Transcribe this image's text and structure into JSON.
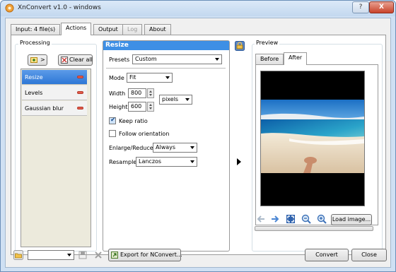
{
  "window": {
    "title": "XnConvert v1.0 - windows",
    "help_label": "?",
    "close_label": "X"
  },
  "tabs": [
    {
      "label": "Input: 4 file(s)",
      "state": "normal"
    },
    {
      "label": "Actions",
      "state": "active"
    },
    {
      "label": "Output",
      "state": "normal"
    },
    {
      "label": "Log",
      "state": "disabled"
    },
    {
      "label": "About",
      "state": "normal"
    }
  ],
  "processing": {
    "title": "Processing",
    "add_button_label": ">",
    "clear_label": "Clear all",
    "items": [
      {
        "label": "Resize",
        "selected": true
      },
      {
        "label": "Levels",
        "selected": false
      },
      {
        "label": "Gaussian blur",
        "selected": false
      }
    ]
  },
  "resize": {
    "header": "Resize",
    "presets_label": "Presets",
    "presets_value": "Custom",
    "mode_label": "Mode",
    "mode_value": "Fit",
    "width_label": "Width",
    "width_value": "800",
    "height_label": "Height",
    "height_value": "600",
    "unit_value": "pixels",
    "keep_ratio_label": "Keep ratio",
    "keep_ratio_checked": true,
    "follow_orientation_label": "Follow orientation",
    "follow_orientation_checked": false,
    "enlarge_label": "Enlarge/Reduce",
    "enlarge_value": "Always",
    "resample_label": "Resample",
    "resample_value": "Lanczos"
  },
  "preview": {
    "title": "Preview",
    "tabs": [
      {
        "label": "Before"
      },
      {
        "label": "After"
      }
    ],
    "load_image_label": "Load image..."
  },
  "bottom": {
    "export_label": "Export for NConvert...",
    "convert_label": "Convert",
    "close_label": "Close"
  },
  "colors": {
    "accent": "#3e8fe5",
    "selection": "#2d77d6",
    "window_frame": "#cfe0f3",
    "remove": "#e35b4a"
  }
}
